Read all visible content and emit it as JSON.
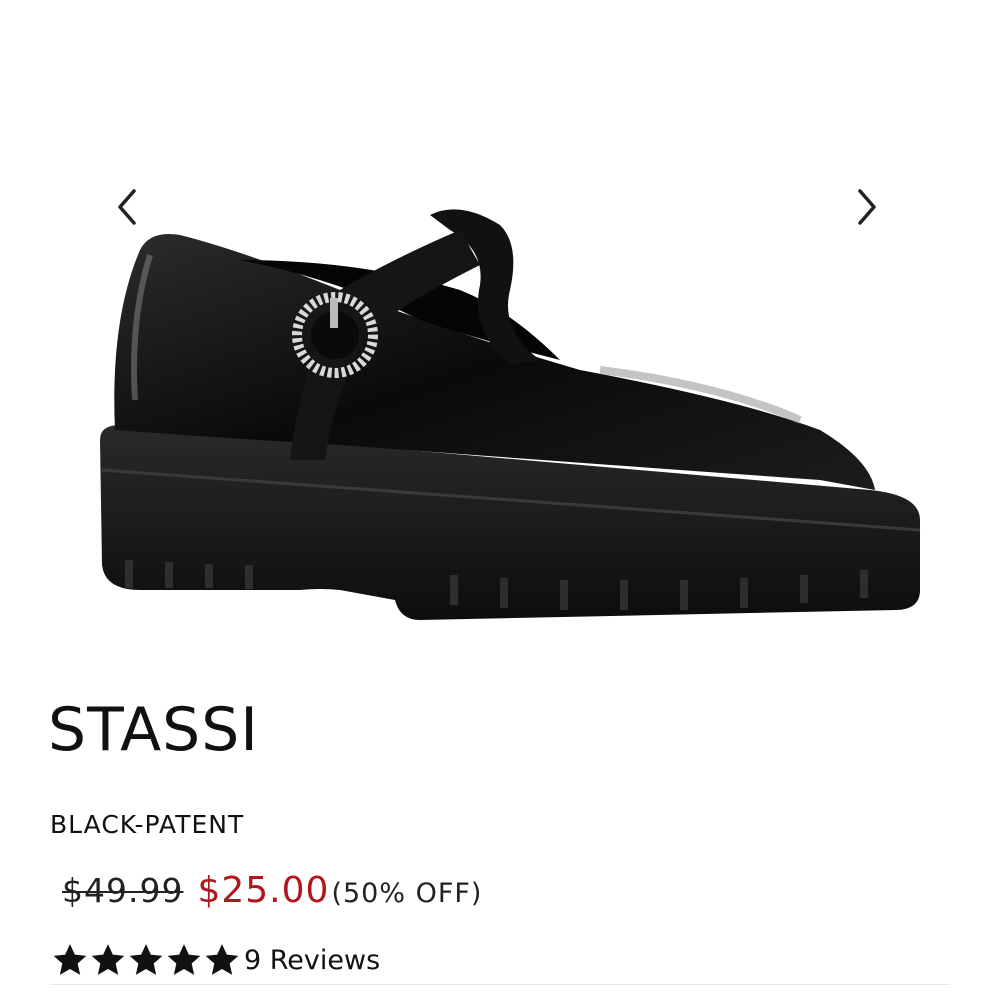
{
  "product": {
    "name": "STASSI",
    "color": "BLACK-PATENT",
    "price_original": "$49.99",
    "price_sale": "$25.00",
    "discount": "(50% OFF)",
    "rating": 5,
    "rating_max": 5,
    "reviews_label": "9 Reviews"
  },
  "gallery": {
    "prev_icon": "chevron-left-icon",
    "next_icon": "chevron-right-icon"
  },
  "colors": {
    "sale_price": "#b0161b",
    "text": "#111111",
    "star": "#111111"
  }
}
